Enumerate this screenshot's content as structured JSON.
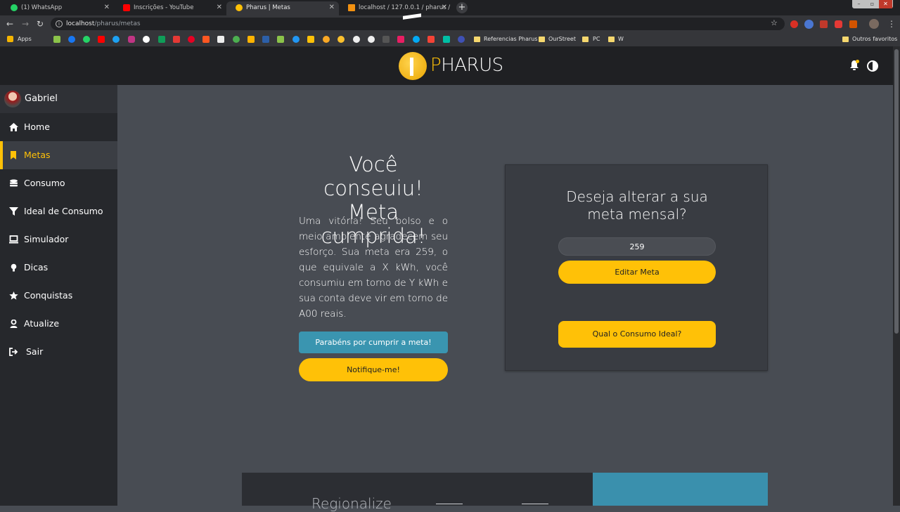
{
  "browser": {
    "tabs": [
      {
        "title": "(1) WhatsApp",
        "color": "#25d366"
      },
      {
        "title": "Inscrições - YouTube",
        "color": "#ff0000"
      },
      {
        "title": "Pharus | Metas",
        "color": "#ffc107"
      },
      {
        "title": "localhost / 127.0.0.1 / pharus / c...",
        "color": "#f29111"
      }
    ],
    "new_tab": "+",
    "url_host": "localhost",
    "url_path": "/pharus/metas",
    "bookmarks": {
      "apps": "Apps",
      "folders": [
        "Referencias Pharus",
        "OurStreet",
        "PC",
        "W"
      ],
      "other": "Outros favoritos"
    }
  },
  "header": {
    "logo_p": "P",
    "logo_rest": "HARUS"
  },
  "sidebar": {
    "user_name": "Gabriel",
    "items": [
      {
        "label": "Home",
        "icon": "home-icon"
      },
      {
        "label": "Metas",
        "icon": "bookmark-icon",
        "active": true
      },
      {
        "label": "Consumo",
        "icon": "coins-icon"
      },
      {
        "label": "Ideal de Consumo",
        "icon": "filter-icon"
      },
      {
        "label": "Simulador",
        "icon": "laptop-icon"
      },
      {
        "label": "Dicas",
        "icon": "lightbulb-icon"
      },
      {
        "label": "Conquistas",
        "icon": "star-icon"
      },
      {
        "label": "Atualize",
        "icon": "user-icon"
      },
      {
        "label": "Sair",
        "icon": "sign-out-icon"
      }
    ]
  },
  "main": {
    "hero_title_line1": "Você conseuiu!",
    "hero_title_line2": "Meta cumprida!",
    "hero_text": "Uma vitória! Seu bolso e o meio ambiente agradecem seu esforço. Sua meta era 259, o que equivale a X kWh, você consumiu em torno de Y kWh e sua conta deve vir em torno de A00 reais.",
    "congrats_button": "Parabéns por cumprir a meta!",
    "notify_button": "Notifique-me!",
    "card_title": "Deseja alterar a sua meta mensal?",
    "meta_value": "259",
    "edit_button": "Editar Meta",
    "ideal_button": "Qual o Consumo Ideal?",
    "bottom_heading": "Regionalize"
  },
  "colors": {
    "accent": "#ffc107",
    "blue": "#3a95b0",
    "sidebar_bg": "#26282c",
    "main_bg": "#484c53"
  }
}
